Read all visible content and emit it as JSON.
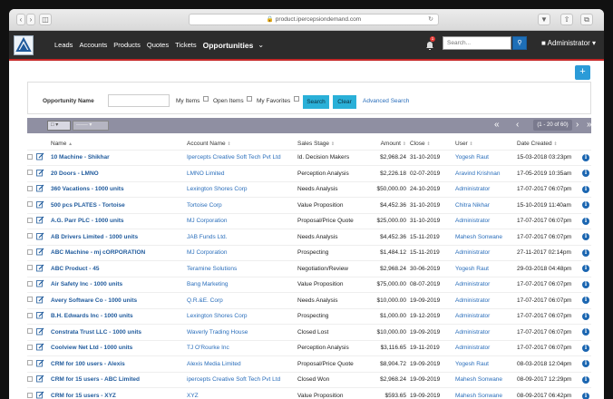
{
  "browser": {
    "url": "product.ipercepsiondemand.com"
  },
  "nav": {
    "items": [
      "Leads",
      "Accounts",
      "Products",
      "Quotes",
      "Tickets"
    ],
    "active": "Opportunities",
    "notification_count": "1",
    "search_placeholder": "Search...",
    "user": "Administrator"
  },
  "filter": {
    "name_label": "Opportunity Name",
    "my_items": "My Items",
    "open_items": "Open Items",
    "my_favorites": "My Favorites",
    "search_btn": "Search",
    "clear_btn": "Clear",
    "advanced": "Advanced Search"
  },
  "grid": {
    "range": "(1 - 20 of 60)",
    "select_label": "",
    "columns": [
      "Name",
      "Account Name",
      "Sales Stage",
      "Amount",
      "Close",
      "User",
      "Date Created"
    ],
    "rows": [
      [
        "10 Machine - Shikhar",
        "Ipercepts Creative Soft Tech Pvt Ltd",
        "Id. Decision Makers",
        "$2,968.24",
        "31-10-2019",
        "Yogesh Raut",
        "15-03-2018 03:23pm"
      ],
      [
        "20 Doors - LMNO",
        "LMNO Limited",
        "Perception Analysis",
        "$2,226.18",
        "02-07-2019",
        "Aravind Krishnan",
        "17-05-2019 10:35am"
      ],
      [
        "360 Vacations - 1000 units",
        "Lexington Shores Corp",
        "Needs Analysis",
        "$50,000.00",
        "24-10-2019",
        "Administrator",
        "17-07-2017 06:07pm"
      ],
      [
        "500 pcs PLATES - Tortoise",
        "Tortoise Corp",
        "Value Proposition",
        "$4,452.36",
        "31-10-2019",
        "Chitra Nikhar",
        "15-10-2019 11:40am"
      ],
      [
        "A.G. Parr PLC - 1000 units",
        "MJ Corporation",
        "Proposal/Price Quote",
        "$25,000.00",
        "31-10-2019",
        "Administrator",
        "17-07-2017 06:07pm"
      ],
      [
        "AB Drivers Limited - 1000 units",
        "JAB Funds Ltd.",
        "Needs Analysis",
        "$4,452.36",
        "15-11-2019",
        "Mahesh Sonwane",
        "17-07-2017 06:07pm"
      ],
      [
        "ABC Machine - mj cORPORATION",
        "MJ Corporation",
        "Prospecting",
        "$1,484.12",
        "15-11-2019",
        "Administrator",
        "27-11-2017 02:14pm"
      ],
      [
        "ABC Product - 45",
        "Teramine Solutions",
        "Negotiation/Review",
        "$2,968.24",
        "30-06-2019",
        "Yogesh Raut",
        "29-03-2018 04:48pm"
      ],
      [
        "Air Safety Inc - 1000 units",
        "Bang Marketing",
        "Value Proposition",
        "$75,000.00",
        "08-07-2019",
        "Administrator",
        "17-07-2017 06:07pm"
      ],
      [
        "Avery Software Co - 1000 units",
        "Q.R.&E. Corp",
        "Needs Analysis",
        "$10,000.00",
        "19-09-2019",
        "Administrator",
        "17-07-2017 06:07pm"
      ],
      [
        "B.H. Edwards Inc - 1000 units",
        "Lexington Shores Corp",
        "Prospecting",
        "$1,000.00",
        "19-12-2019",
        "Administrator",
        "17-07-2017 06:07pm"
      ],
      [
        "Constrata Trust LLC - 1000 units",
        "Waverly Trading House",
        "Closed Lost",
        "$10,000.00",
        "19-09-2019",
        "Administrator",
        "17-07-2017 06:07pm"
      ],
      [
        "Coolview Net Ltd - 1000 units",
        "TJ O'Rourke Inc",
        "Perception Analysis",
        "$3,116.65",
        "19-11-2019",
        "Administrator",
        "17-07-2017 06:07pm"
      ],
      [
        "CRM for 100 users - Alexis",
        "Alexis Media Limited",
        "Proposal/Price Quote",
        "$8,904.72",
        "19-09-2019",
        "Yogesh Raut",
        "08-03-2018 12:04pm"
      ],
      [
        "CRM for 15 users - ABC Limited",
        "ipercepts Creative Soft Tech Pvt Ltd",
        "Closed Won",
        "$2,968.24",
        "19-09-2019",
        "Mahesh Sonwane",
        "08-09-2017 12:29pm"
      ],
      [
        "CRM for 15 users - XYZ",
        "XYZ",
        "Value Proposition",
        "$593.65",
        "19-09-2019",
        "Mahesh Sonwane",
        "08-09-2017 06:42pm"
      ]
    ]
  }
}
